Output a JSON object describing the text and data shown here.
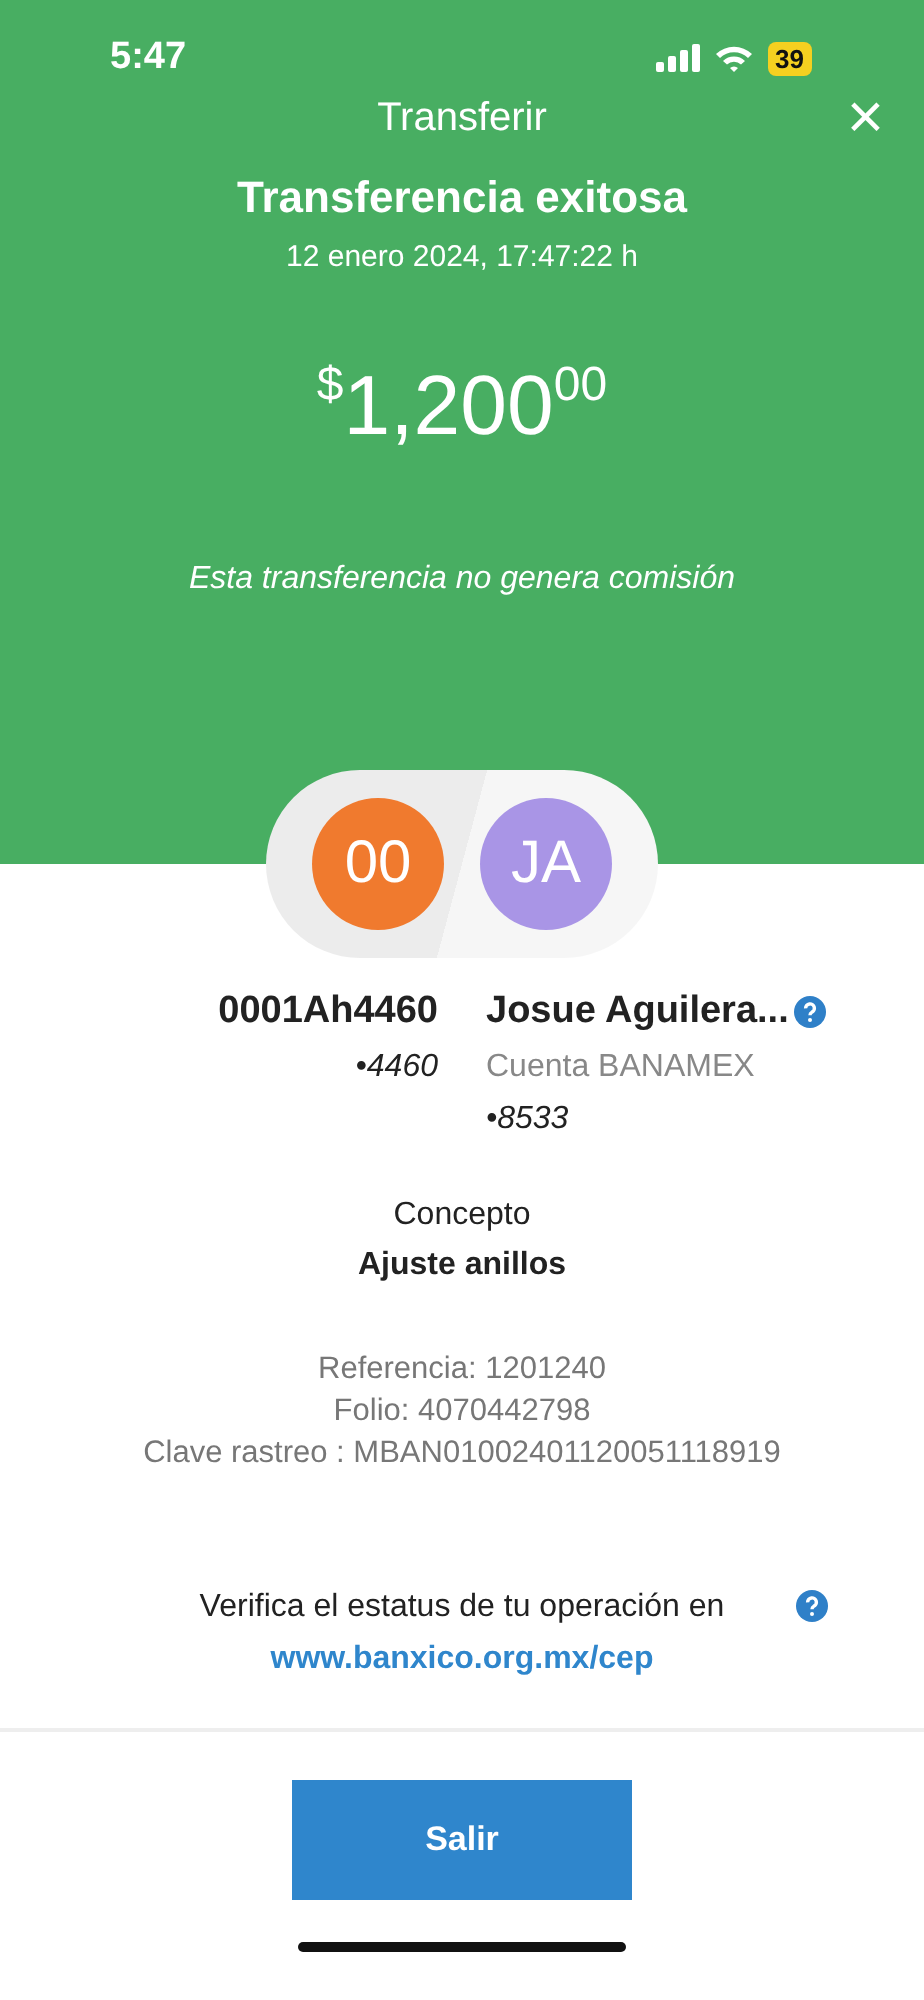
{
  "status_bar": {
    "time": "5:47",
    "battery": "39"
  },
  "header": {
    "title": "Transferir",
    "close": "×"
  },
  "result": {
    "heading": "Transferencia exitosa",
    "date": "12 enero 2024, 17:47:22 h",
    "amount": {
      "currency": "$",
      "whole": "1,200",
      "cents": "00"
    },
    "note": "Esta transferencia no genera comisión"
  },
  "origin": {
    "initials": "00",
    "color": "#f07a2e",
    "name": "0001Ah4460",
    "account": "•4460"
  },
  "destination": {
    "initials": "JA",
    "color": "#a995e6",
    "name": "Josue Aguilera...",
    "bank": "Cuenta BANAMEX",
    "account": "•8533"
  },
  "concept": {
    "label": "Concepto",
    "value": "Ajuste anillos"
  },
  "details": [
    "Referencia: 1201240",
    "Folio: 4070442798",
    "Clave rastreo : MBAN01002401120051118919"
  ],
  "verify": {
    "text": "Verifica el estatus de tu operación en",
    "link": "www.banxico.org.mx/cep"
  },
  "button": "Salir"
}
